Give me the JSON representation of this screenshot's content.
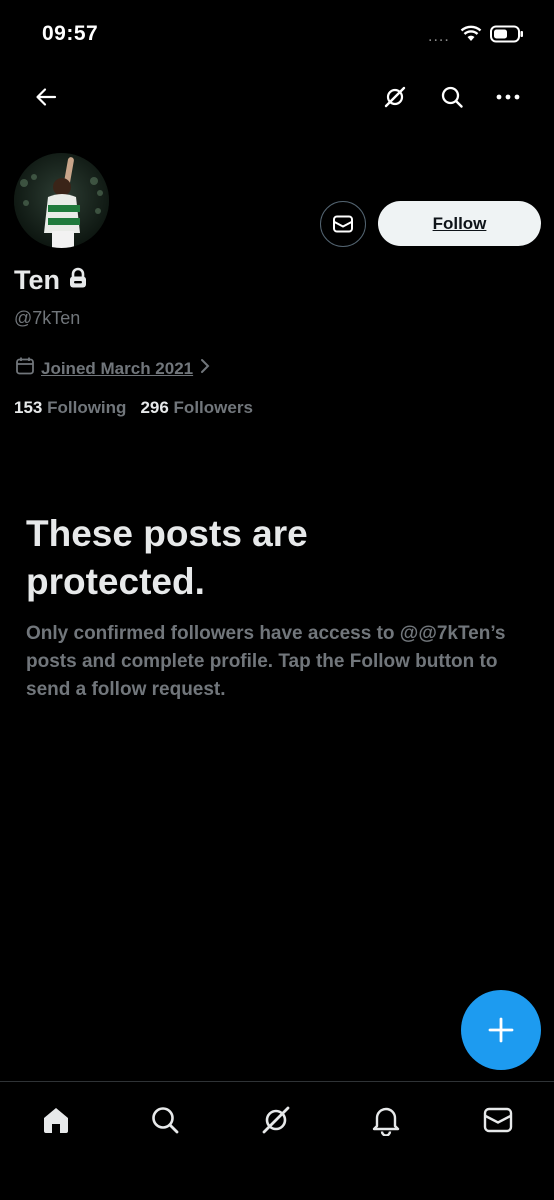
{
  "status_bar": {
    "time": "09:57",
    "signal": "....",
    "icons": [
      "wifi-icon",
      "battery-icon"
    ]
  },
  "top_nav": {
    "icons": [
      "back-arrow-icon",
      "grok-icon",
      "search-icon",
      "more-icon"
    ]
  },
  "profile": {
    "display_name": "Ten",
    "handle": "@7kTen",
    "protected_icon": "lock-icon",
    "joined": "Joined March 2021",
    "following_count": "153",
    "following_label": "Following",
    "followers_count": "296",
    "followers_label": "Followers",
    "follow_label": "Follow",
    "message_icon": "mail-icon"
  },
  "protected_notice": {
    "title": "These posts are protected.",
    "description": "Only confirmed followers have access to @@7kTen’s posts and complete profile. Tap the Follow button to send a follow request."
  },
  "fab": {
    "icon": "plus-icon"
  },
  "bottom_nav": {
    "tabs": [
      "home-icon",
      "search-icon",
      "grok-icon",
      "notifications-icon",
      "messages-icon"
    ]
  },
  "colors": {
    "background": "#000000",
    "text_primary": "#e7e9ea",
    "text_secondary": "#71767b",
    "accent": "#1d9bf0",
    "follow_button_bg": "#eff3f4"
  }
}
